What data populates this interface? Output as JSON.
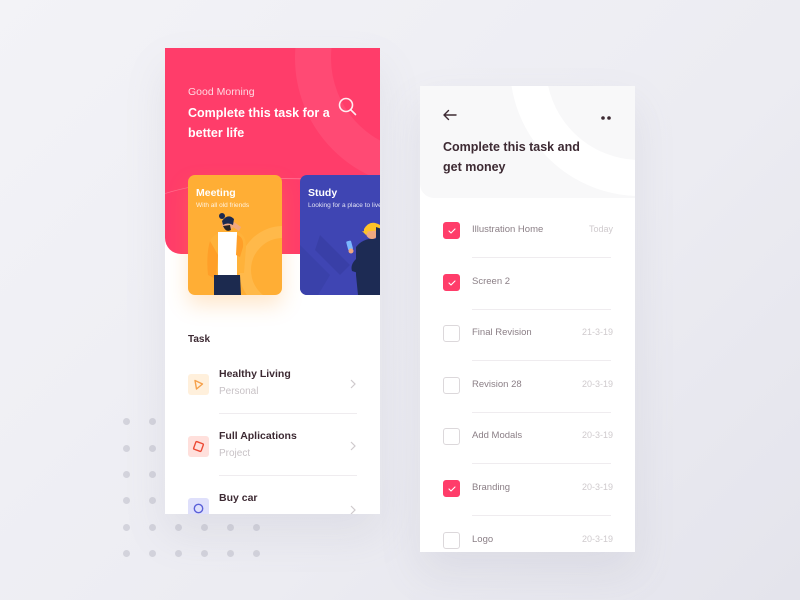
{
  "colors": {
    "accent": "#ff3d6a",
    "meeting_card": "#ffae35",
    "study_card": "#3f45b3",
    "text_dark": "#3d2a33",
    "text_muted": "#c8c2c6"
  },
  "home": {
    "greeting": "Good Morning",
    "headline": "Complete this task for a better life",
    "search_icon": "search-icon",
    "cards": [
      {
        "title": "Meeting",
        "subtitle": "With all old friends"
      },
      {
        "title": "Study",
        "subtitle": "Looking for a place to live"
      }
    ],
    "task_section_label": "Task",
    "tasks": [
      {
        "title": "Healthy Living",
        "category": "Personal",
        "icon": "play-triangle-icon",
        "icon_color": "#f5a04a",
        "icon_bg": "#fff0dc"
      },
      {
        "title": "Full Aplications",
        "category": "Project",
        "icon": "rotated-square-icon",
        "icon_color": "#ec4a35",
        "icon_bg": "#ffe0dc"
      },
      {
        "title": "Buy car",
        "category": "",
        "icon": "circle-icon",
        "icon_color": "#5a60d8",
        "icon_bg": "#dfe0fb"
      }
    ]
  },
  "detail": {
    "back_icon": "arrow-left-icon",
    "more_icon": "more-dots-icon",
    "title": "Complete this task and get money",
    "items": [
      {
        "label": "Illustration Home",
        "date": "Today",
        "checked": true
      },
      {
        "label": "Screen 2",
        "date": "",
        "checked": true
      },
      {
        "label": "Final Revision",
        "date": "21-3-19",
        "checked": false
      },
      {
        "label": "Revision 28",
        "date": "20-3-19",
        "checked": false
      },
      {
        "label": "Add Modals",
        "date": "20-3-19",
        "checked": false
      },
      {
        "label": "Branding",
        "date": "20-3-19",
        "checked": true
      },
      {
        "label": "Logo",
        "date": "20-3-19",
        "checked": false
      }
    ]
  }
}
